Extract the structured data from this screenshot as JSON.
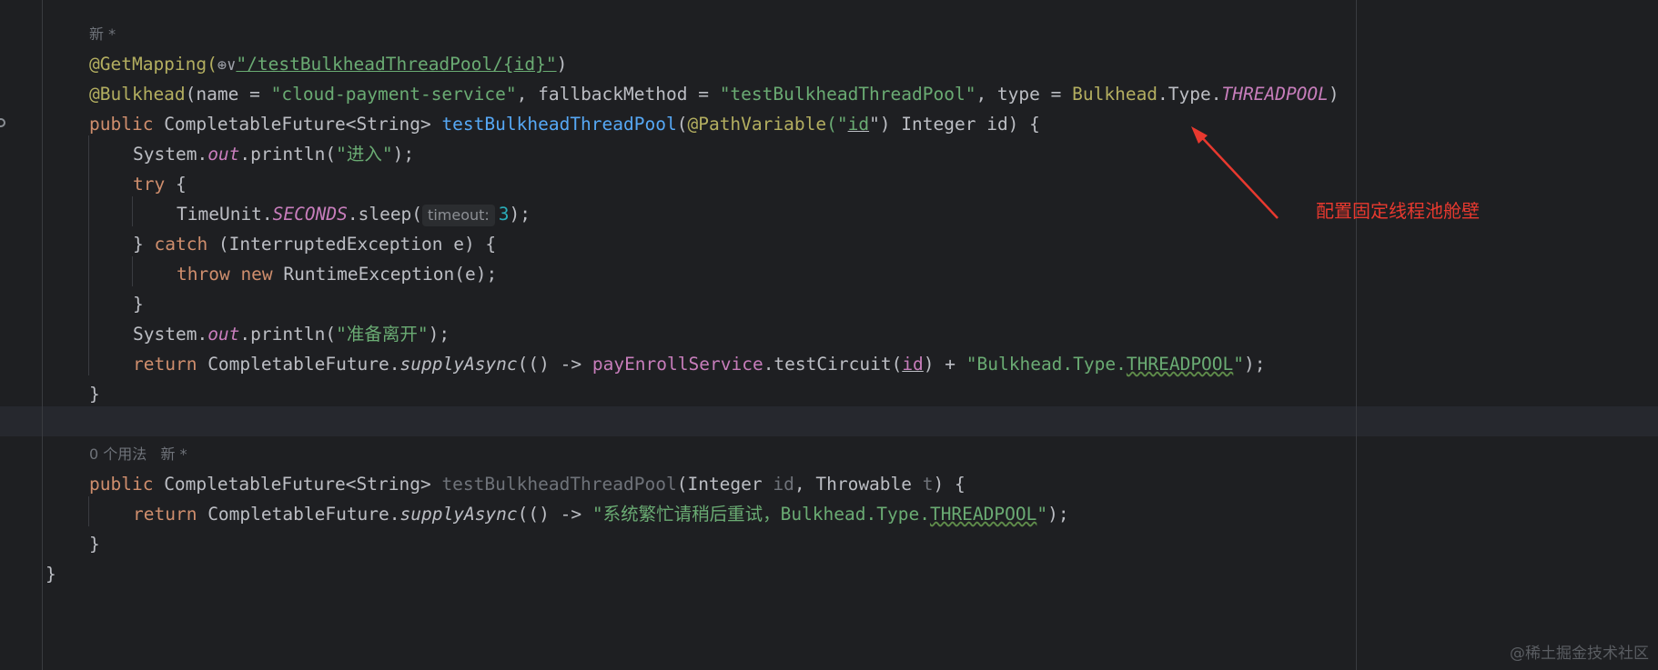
{
  "lines": [
    {
      "meta": "新 *"
    },
    {
      "seg": [
        "@GetMapping(",
        "⊕∨",
        "\"/testBulkheadThreadPool/{id}\"",
        ")"
      ]
    },
    {
      "seg": [
        "@Bulkhead",
        "(name = ",
        "\"cloud-payment-service\"",
        ", fallbackMethod = ",
        "\"testBulkheadThreadPool\"",
        ", type = ",
        "Bulkhead",
        ".Type.",
        "THREADPOOL",
        ")"
      ]
    },
    {
      "seg": [
        "public ",
        "CompletableFuture<String> ",
        "testBulkheadThreadPool",
        "(",
        "@PathVariable",
        "(\"",
        "id",
        "\") Integer id) {"
      ]
    },
    {
      "seg": [
        "System.",
        "out",
        ".println(",
        "\"进入\"",
        ");"
      ]
    },
    {
      "seg": [
        "try",
        " {"
      ]
    },
    {
      "seg": [
        "TimeUnit.",
        "SECONDS",
        ".sleep(",
        "timeout:",
        "3",
        ");"
      ]
    },
    {
      "seg": [
        "} ",
        "catch",
        " (InterruptedException e) {"
      ]
    },
    {
      "seg": [
        "throw new",
        " RuntimeException(e);"
      ]
    },
    {
      "seg": [
        "}"
      ]
    },
    {
      "seg": [
        "System.",
        "out",
        ".println(",
        "\"准备离开\"",
        ");"
      ]
    },
    {
      "seg": [
        "return",
        " CompletableFuture.",
        "supplyAsync",
        "(() -> ",
        "payEnrollService",
        ".testCircuit(",
        "id",
        ") + ",
        "\"Bulkhead.Type.",
        "THREADPOOL",
        "\"",
        ");"
      ]
    },
    {
      "seg": [
        "}"
      ]
    },
    {
      "meta": "0 个用法   新 *"
    },
    {
      "seg": [
        "public ",
        "CompletableFuture<String> ",
        "testBulkheadThreadPool",
        "(Integer ",
        "id",
        ", Throwable ",
        "t",
        ") {"
      ]
    },
    {
      "seg": [
        "return",
        " CompletableFuture.",
        "supplyAsync",
        "(() -> ",
        "\"系统繁忙请稍后重试，Bulkhead.Type.",
        "THREADPOOL",
        "\"",
        ");"
      ]
    },
    {
      "seg": [
        "}"
      ]
    },
    {
      "seg": [
        "}"
      ]
    }
  ],
  "annotation": {
    "text": "配置固定线程池舱壁",
    "color": "#e8392f"
  },
  "watermark": "@稀土掘金技术社区",
  "colors": {
    "background": "#1e1f22",
    "keyword": "#cf8e6d",
    "annotation": "#b3ae60",
    "string": "#6aab73",
    "method": "#56a8f5",
    "field": "#c77dbb"
  }
}
